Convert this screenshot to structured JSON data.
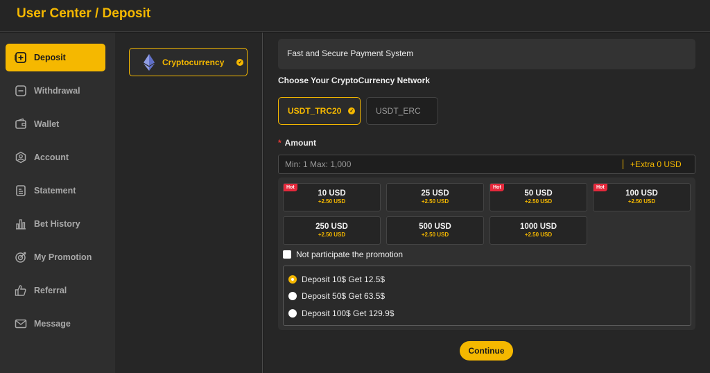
{
  "header": {
    "title": "User Center / Deposit"
  },
  "sidebar": {
    "items": [
      {
        "label": "Deposit",
        "icon": "plus-square-icon",
        "active": true
      },
      {
        "label": "Withdrawal",
        "icon": "minus-square-icon"
      },
      {
        "label": "Wallet",
        "icon": "wallet-icon"
      },
      {
        "label": "Account",
        "icon": "account-icon"
      },
      {
        "label": "Statement",
        "icon": "statement-icon"
      },
      {
        "label": "Bet History",
        "icon": "bar-chart-icon"
      },
      {
        "label": "My Promotion",
        "icon": "target-icon"
      },
      {
        "label": "Referral",
        "icon": "thumbs-up-icon"
      },
      {
        "label": "Message",
        "icon": "envelope-icon"
      }
    ]
  },
  "methods": {
    "selected": "Cryptocurrency",
    "icon": "ethereum-icon"
  },
  "main": {
    "banner": "Fast and Secure Payment System",
    "network_title": "Choose Your CryptoCurrency Network",
    "networks": [
      {
        "label": "USDT_TRC20",
        "selected": true
      },
      {
        "label": "USDT_ERC",
        "selected": false
      }
    ],
    "amount_label": "Amount",
    "amount_placeholder": "Min: 1 Max: 1,000",
    "extra": "+Extra 0 USD",
    "hot_label": "Hot",
    "amounts": [
      {
        "value": "10 USD",
        "bonus": "+2.50 USD",
        "hot": true
      },
      {
        "value": "25 USD",
        "bonus": "+2.50 USD",
        "hot": false
      },
      {
        "value": "50 USD",
        "bonus": "+2.50 USD",
        "hot": true
      },
      {
        "value": "100 USD",
        "bonus": "+2.50 USD",
        "hot": true
      },
      {
        "value": "250 USD",
        "bonus": "+2.50 USD",
        "hot": false
      },
      {
        "value": "500 USD",
        "bonus": "+2.50 USD",
        "hot": false
      },
      {
        "value": "1000 USD",
        "bonus": "+2.50 USD",
        "hot": false
      }
    ],
    "not_participate": "Not participate the promotion",
    "promotions": [
      {
        "label": "Deposit 10$ Get 12.5$",
        "selected": true
      },
      {
        "label": "Deposit 50$ Get 63.5$",
        "selected": false
      },
      {
        "label": "Deposit 100$ Get 129.9$",
        "selected": false
      }
    ],
    "continue": "Continue"
  },
  "colors": {
    "accent": "#f5b800",
    "hot": "#e5283b",
    "background": "#262626"
  }
}
